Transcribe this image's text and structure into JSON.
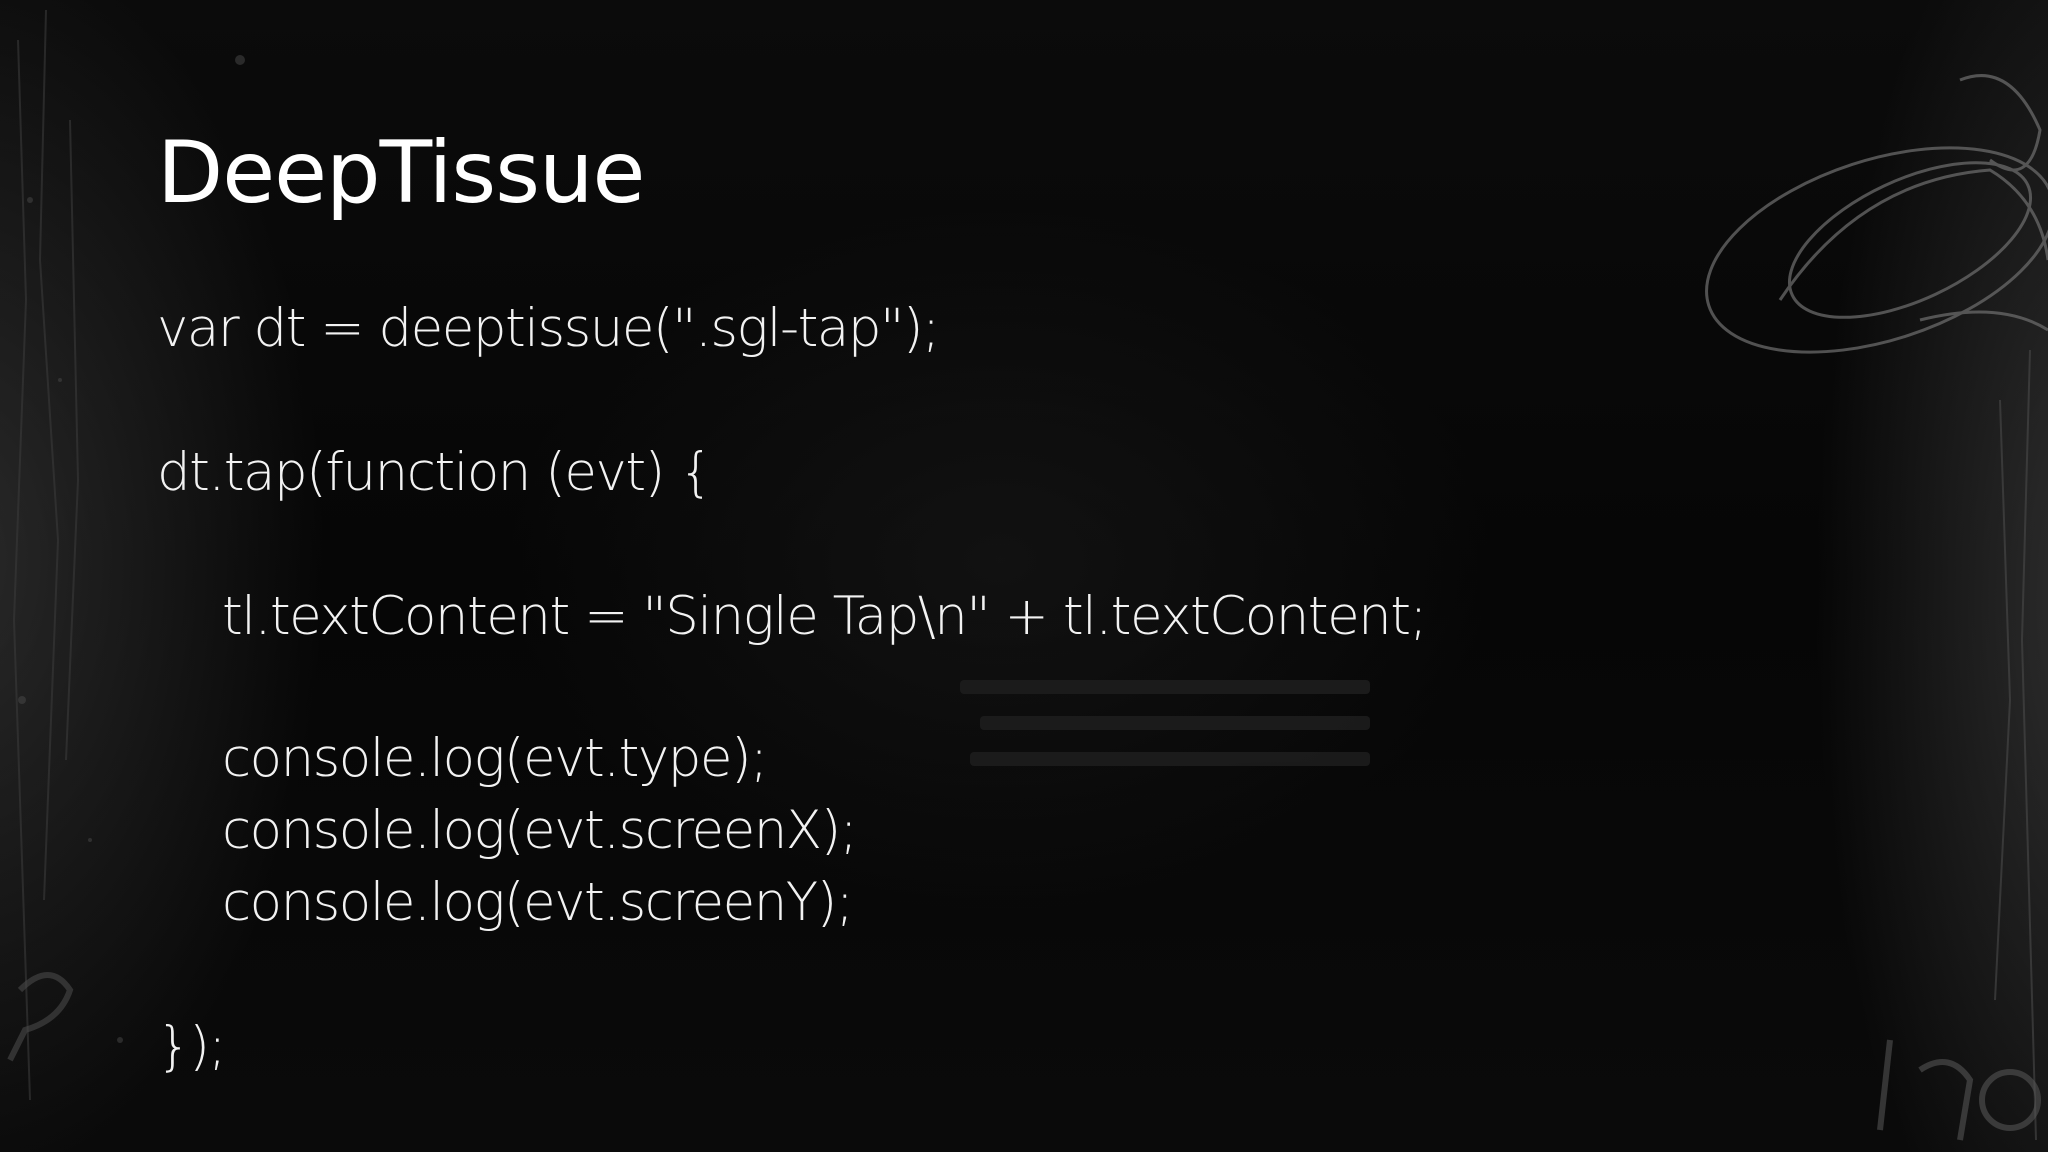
{
  "slide": {
    "title": "DeepTissue",
    "code_lines": [
      "var dt = deeptissue(\".sgl-tap\");",
      "dt.tap(function (evt) {",
      "tl.textContent = \"Single Tap\\n\" + tl.textContent;",
      "console.log(evt.type);",
      "console.log(evt.screenX);",
      "console.log(evt.screenY);",
      "});"
    ]
  },
  "colors": {
    "background": "#050505",
    "text": "#ffffff",
    "decoration": "#5a5a5a"
  }
}
